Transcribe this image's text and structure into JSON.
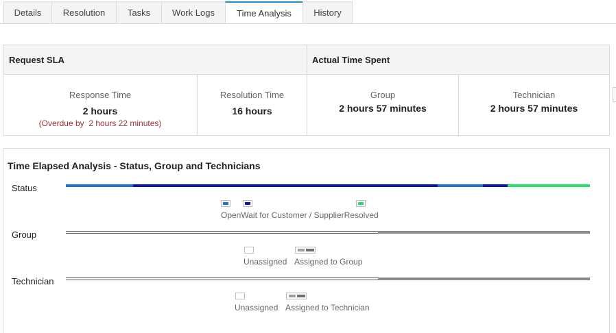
{
  "tabs": [
    "Details",
    "Resolution",
    "Tasks",
    "Work Logs",
    "Time Analysis",
    "History"
  ],
  "sla": {
    "request_sla_title": "Request SLA",
    "actual_time_title": "Actual Time Spent",
    "response_label": "Response Time",
    "response_value": "2 hours",
    "overdue_prefix": "(Overdue by",
    "overdue_value": "2 hours 22 minutes)",
    "resolution_label": "Resolution Time",
    "resolution_value": "16 hours",
    "group_label": "Group",
    "group_value": "2 hours 57 minutes",
    "technician_label": "Technician",
    "technician_value": "2 hours 57 minutes"
  },
  "analysis": {
    "title": "Time Elapsed Analysis - Status, Group and Technicians",
    "status_label": "Status",
    "group_label": "Group",
    "technician_label": "Technician",
    "status_legend": {
      "open": "Open",
      "wait": "Wait for Customer / Supplier",
      "resolved": "Resolved"
    },
    "group_legend": {
      "unassigned": "Unassigned",
      "assigned": "Assigned to Group"
    },
    "technician_legend": {
      "unassigned": "Unassigned",
      "assigned": "Assigned to Technician"
    }
  },
  "colors": {
    "open": "#1f6fd6",
    "wait": "#0d12b8",
    "resolved": "#22e06a",
    "assigned": "#8c8c8c",
    "unassigned_line": "#555555",
    "active_tab": "#1a8fd6",
    "overdue": "#a03030"
  }
}
